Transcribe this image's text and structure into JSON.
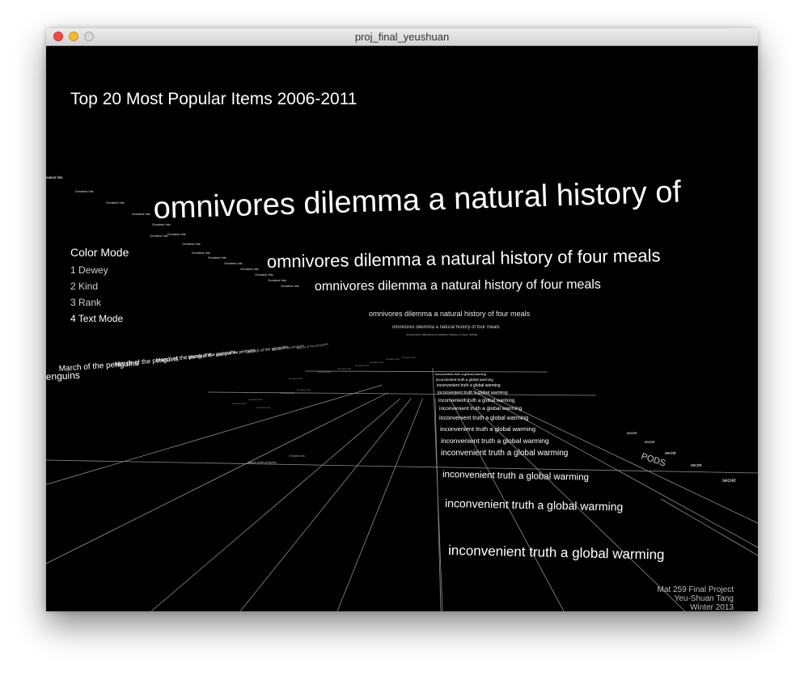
{
  "window": {
    "title": "proj_final_yeushuan"
  },
  "viz": {
    "title": "Top 20 Most Popular Items 2006-2011",
    "color_mode": {
      "heading": "Color Mode",
      "options": [
        "1 Dewey",
        "2 Kind",
        "3 Rank",
        "4 Text Mode"
      ],
      "selected": "4 Text Mode"
    },
    "credits": [
      "Mat 259 Final Project",
      "Yeu-Shuan Tang",
      "Winter 2013"
    ],
    "items": {
      "omnivore": "omnivores dilemma a natural history of four meals",
      "omnivore_cut": "omnivores dilemma a natural history of",
      "inconvenient": "inconvenient truth a global warming",
      "penguins": "March of the penguins",
      "penguins_cut": "enguins",
      "secret": "secret",
      "greatest": "Greatest hits",
      "greatest_cut": "eatest hits",
      "pods": "PODS"
    },
    "colors": {
      "background": "#000000",
      "grid": "#8c8c8c",
      "text": "#ffffff"
    }
  }
}
